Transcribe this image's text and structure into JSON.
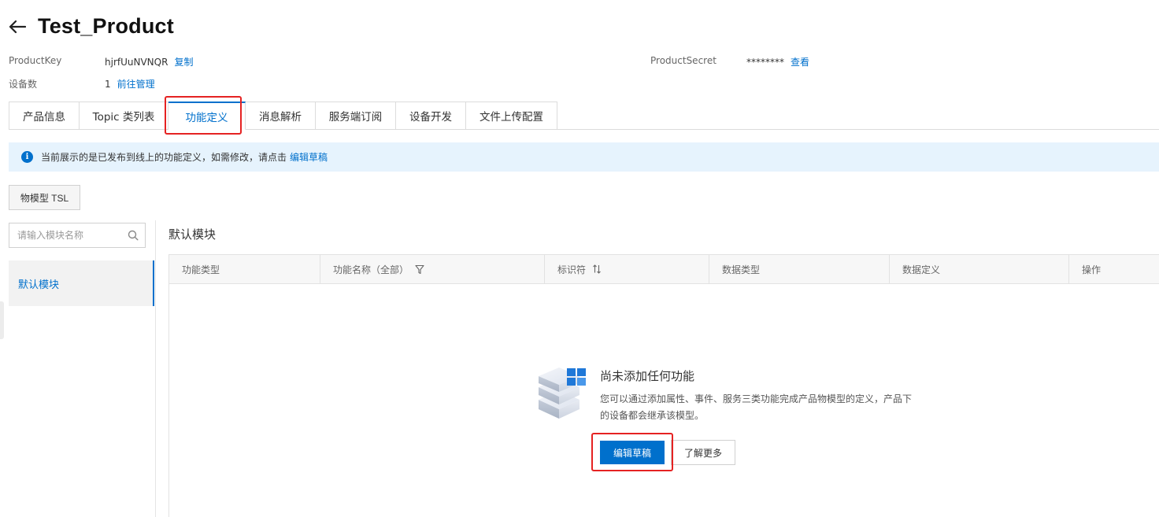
{
  "header": {
    "back_icon": "arrow-left-icon",
    "title": "Test_Product"
  },
  "meta": {
    "product_key_label": "ProductKey",
    "product_key_value": "hjrfUuNVNQR",
    "copy_label": "复制",
    "product_secret_label": "ProductSecret",
    "product_secret_value": "********",
    "view_label": "查看",
    "device_count_label": "设备数",
    "device_count_value": "1",
    "manage_label": "前往管理"
  },
  "tabs": [
    {
      "label": "产品信息"
    },
    {
      "label": "Topic 类列表"
    },
    {
      "label": "功能定义",
      "active": true
    },
    {
      "label": "消息解析"
    },
    {
      "label": "服务端订阅"
    },
    {
      "label": "设备开发"
    },
    {
      "label": "文件上传配置"
    }
  ],
  "notice": {
    "icon": "info-icon",
    "text": "当前展示的是已发布到线上的功能定义，如需修改，请点击",
    "link": "编辑草稿"
  },
  "tsl_button_label": "物模型 TSL",
  "sidebar": {
    "search_placeholder": "请输入模块名称",
    "items": [
      {
        "label": "默认模块",
        "active": true
      }
    ]
  },
  "main": {
    "module_title": "默认模块",
    "columns": [
      "功能类型",
      "功能名称（全部）",
      "标识符",
      "数据类型",
      "数据定义",
      "操作"
    ],
    "empty": {
      "title": "尚未添加任何功能",
      "desc_line1": "您可以通过添加属性、事件、服务三类功能完成产品物模型的定义，产品下",
      "desc_line2": "的设备都会继承该模型。",
      "primary_label": "编辑草稿",
      "secondary_label": "了解更多"
    }
  },
  "colors": {
    "accent": "#0070cc",
    "highlight": "#e52222",
    "notice_bg": "#e6f3fd"
  }
}
